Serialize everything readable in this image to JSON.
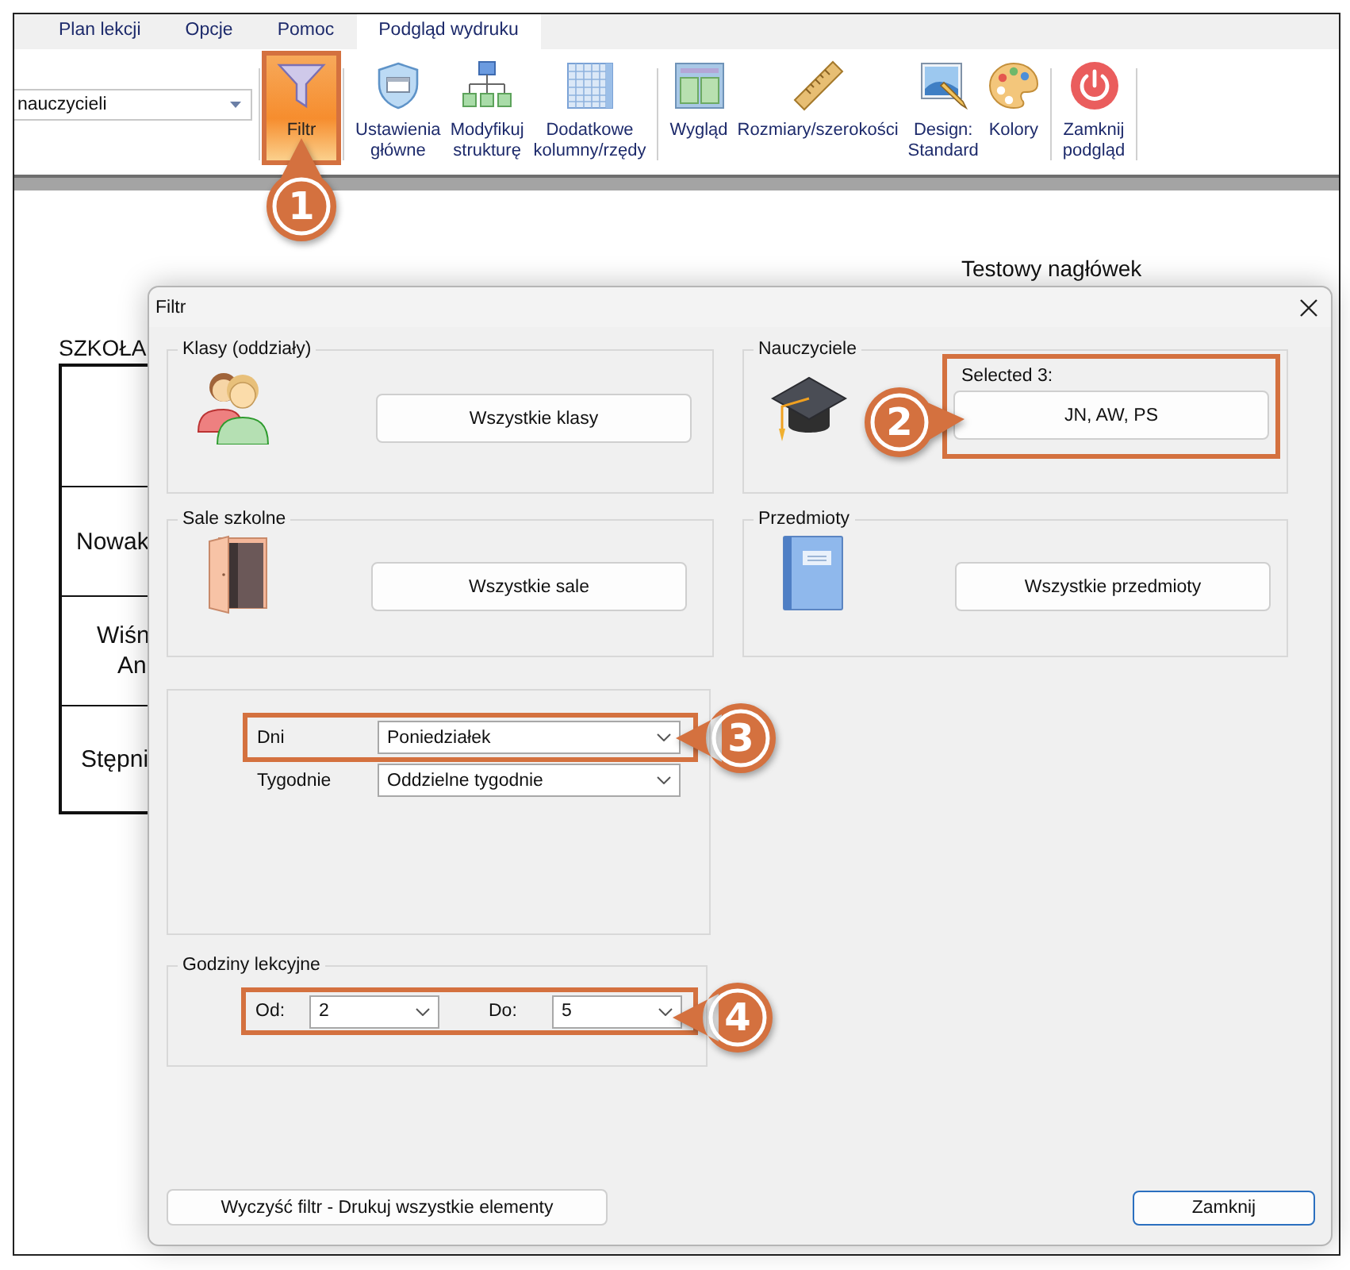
{
  "tabs": [
    {
      "label": "Plan lekcji",
      "selected": false
    },
    {
      "label": "Opcje",
      "selected": false
    },
    {
      "label": "Pomoc",
      "selected": false
    },
    {
      "label": "Podgląd wydruku",
      "selected": true
    }
  ],
  "ribbon": {
    "view_select": {
      "value": "nauczycieli"
    },
    "groups": [
      [
        {
          "kind": "filter",
          "lines": [
            "Filtr"
          ],
          "active": true
        }
      ],
      [
        {
          "kind": "settings",
          "lines": [
            "Ustawienia",
            "główne"
          ],
          "active": false
        },
        {
          "kind": "structure",
          "lines": [
            "Modyfikuj",
            "strukturę"
          ],
          "active": false
        },
        {
          "kind": "columns",
          "lines": [
            "Dodatkowe",
            "kolumny/rzędy"
          ],
          "active": false
        }
      ],
      [
        {
          "kind": "layout",
          "lines": [
            "Wygląd"
          ],
          "active": false
        },
        {
          "kind": "sizes",
          "lines": [
            "Rozmiary/szerokości"
          ],
          "active": false
        },
        {
          "kind": "design",
          "lines": [
            "Design:",
            "Standard"
          ],
          "active": false
        },
        {
          "kind": "colors",
          "lines": [
            "Kolory"
          ],
          "active": false
        }
      ],
      [
        {
          "kind": "close",
          "lines": [
            "Zamknij",
            "podgląd"
          ],
          "active": false
        }
      ]
    ]
  },
  "preview": {
    "header": "Testowy nagłówek",
    "school": "SZKOŁA",
    "rows": [
      [],
      [
        "Nowak"
      ],
      [
        "Wiśn",
        "An"
      ],
      [
        "Stępni"
      ]
    ]
  },
  "dialog": {
    "title": "Filtr",
    "groups": [
      {
        "kind": "classes",
        "legend": "Klasy (oddziały)",
        "button": "Wszystkie klasy"
      },
      {
        "kind": "teachers",
        "legend": "Nauczyciele",
        "caption": "Selected 3:",
        "button": "JN, AW, PS"
      },
      {
        "kind": "rooms",
        "legend": "Sale szkolne",
        "button": "Wszystkie sale"
      },
      {
        "kind": "subjects",
        "legend": "Przedmioty",
        "button": "Wszystkie przedmioty"
      }
    ],
    "days": [
      {
        "label": "Dni",
        "value": "Poniedziałek"
      },
      {
        "label": "Tygodnie",
        "value": "Oddzielne tygodnie"
      }
    ],
    "hours": {
      "legend": "Godziny lekcyjne",
      "from": {
        "label": "Od:",
        "value": "2"
      },
      "to": {
        "label": "Do:",
        "value": "5"
      }
    },
    "clear_button": "Wyczyść filtr - Drukuj wszystkie elementy",
    "close_button": "Zamknij"
  },
  "callouts": [
    {
      "number": "1"
    },
    {
      "number": "2"
    },
    {
      "number": "3"
    },
    {
      "number": "4"
    }
  ]
}
